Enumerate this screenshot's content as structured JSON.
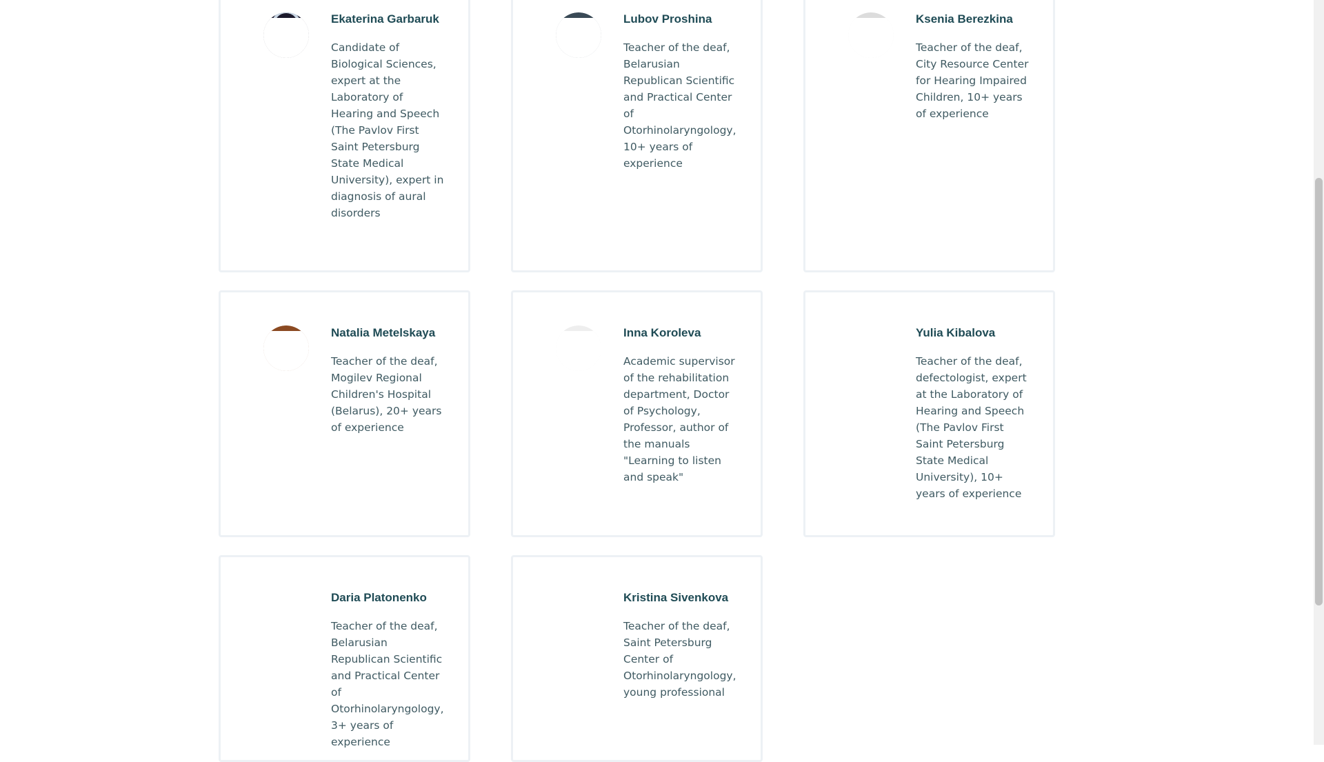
{
  "team": [
    {
      "name": "Ekaterina Garbaruk",
      "description": "Candidate of Biological Sciences, expert at the Laboratory of Hearing and Speech (The Pavlov First Saint Petersburg State Medical University), expert in diagnosis of aural disorders",
      "photo_color": "#1c1a2c",
      "photo_accent": "#c9d6e3"
    },
    {
      "name": "Lubov Proshina",
      "description": "Teacher of the deaf, Belarusian Republican Scientific and Practical Center of Otorhinolaryngology, 10+ years of experience",
      "photo_color": "#3a4a56",
      "photo_accent": "#ffffff"
    },
    {
      "name": "Ksenia Berezkina",
      "description": "Teacher of the deaf, City Resource Center for Hearing Impaired Children, 10+ years of experience",
      "photo_color": "#dcdcdc",
      "photo_accent": "#ffffff"
    },
    {
      "name": "Natalia Metelskaya",
      "description": "Teacher of the deaf, Mogilev Regional Children's Hospital (Belarus), 20+ years of experience",
      "photo_color": "#8b4a22",
      "photo_accent": "#8b4a22"
    },
    {
      "name": "Inna Koroleva",
      "description": "Academic supervisor of the rehabilitation department, Doctor of Psychology, Professor, author of the manuals \"Learning to listen and speak\"",
      "photo_color": "#eeeeee",
      "photo_accent": "#ffffff"
    },
    {
      "name": "Yulia Kibalova",
      "description": "Teacher of the deaf, defectologist, expert at the Laboratory of Hearing and Speech (The Pavlov First Saint Petersburg State Medical University), 10+ years of experience",
      "photo_color": "#ffffff",
      "photo_accent": "#ffffff"
    },
    {
      "name": "Daria Platonenko",
      "description": "Teacher of the deaf, Belarusian Republican Scientific and Practical Center of Otorhinolaryngology, 3+ years of experience",
      "photo_color": "#ffffff",
      "photo_accent": "#ffffff"
    },
    {
      "name": "Kristina Sivenkova",
      "description": "Teacher of the deaf, Saint Petersburg Center of Otorhinolaryngology, young professional",
      "photo_color": "#ffffff",
      "photo_accent": "#ffffff"
    }
  ]
}
